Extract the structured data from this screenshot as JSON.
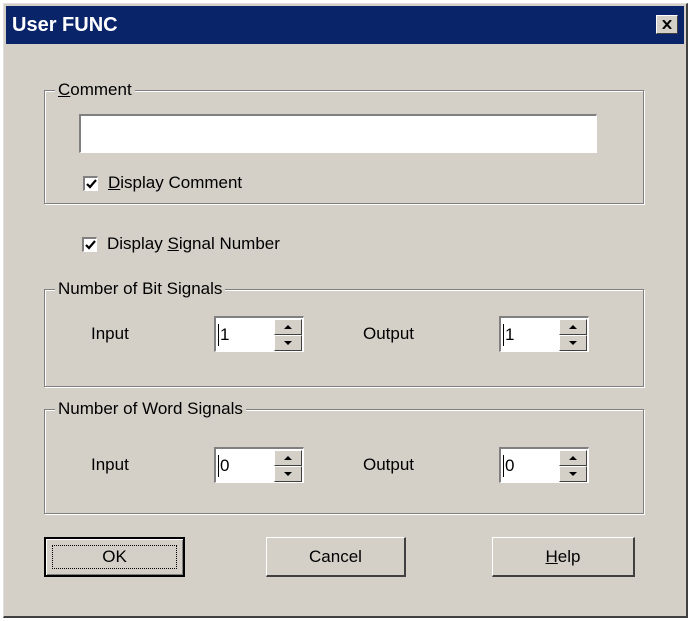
{
  "dialog": {
    "title": "User FUNC",
    "close_glyph": "close-icon"
  },
  "comment_group": {
    "legend_accel": "C",
    "legend_rest": "omment",
    "value": "",
    "display_comment": {
      "accel": "D",
      "rest": "isplay Comment",
      "checked": true
    }
  },
  "display_signal_number": {
    "pre": "Display ",
    "accel": "S",
    "rest": "ignal Number",
    "checked": true
  },
  "bit_signals": {
    "legend": "Number of Bit Signals",
    "input_label": "Input",
    "input_value": "1",
    "output_label": "Output",
    "output_value": "1"
  },
  "word_signals": {
    "legend": "Number of Word Signals",
    "input_label": "Input",
    "input_value": "0",
    "output_label": "Output",
    "output_value": "0"
  },
  "buttons": {
    "ok": "OK",
    "cancel": "Cancel",
    "help_accel": "H",
    "help_rest": "elp"
  },
  "colors": {
    "titlebar": "#0a246a",
    "face": "#d4d0c8"
  }
}
